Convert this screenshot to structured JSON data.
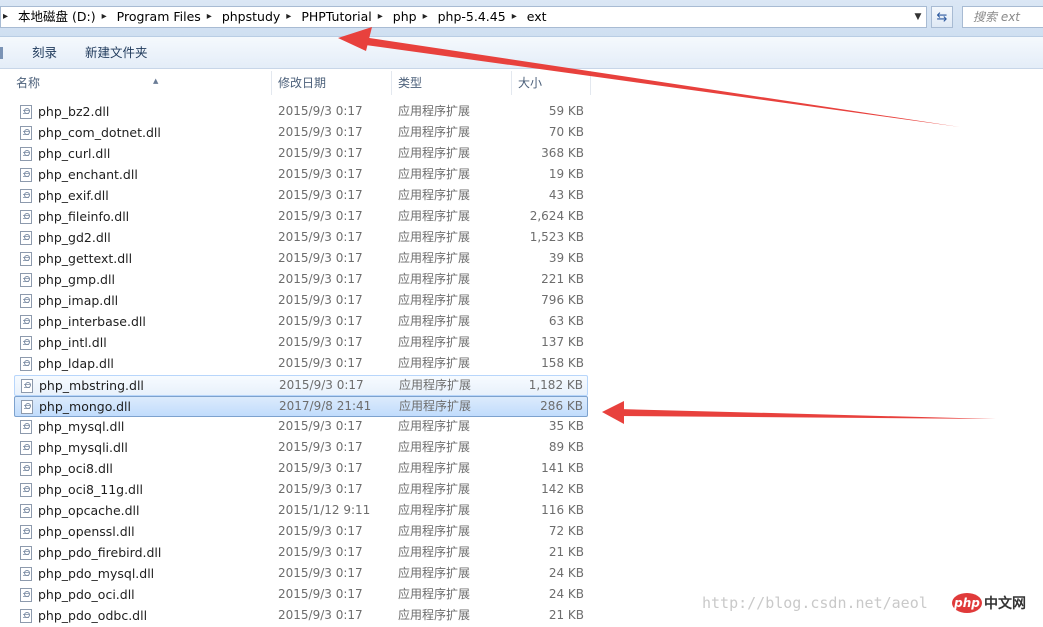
{
  "address_bar": {
    "breadcrumbs": [
      "本地磁盘 (D:)",
      "Program Files",
      "phpstudy",
      "PHPTutorial",
      "php",
      "php-5.4.45",
      "ext"
    ],
    "search_placeholder": "搜索 ext"
  },
  "toolbar": {
    "burn_label": "刻录",
    "new_folder_label": "新建文件夹"
  },
  "columns": {
    "name": "名称",
    "date": "修改日期",
    "type": "类型",
    "size": "大小"
  },
  "files": [
    {
      "name": "php_bz2.dll",
      "date": "2015/9/3 0:17",
      "type": "应用程序扩展",
      "size": "59 KB"
    },
    {
      "name": "php_com_dotnet.dll",
      "date": "2015/9/3 0:17",
      "type": "应用程序扩展",
      "size": "70 KB"
    },
    {
      "name": "php_curl.dll",
      "date": "2015/9/3 0:17",
      "type": "应用程序扩展",
      "size": "368 KB"
    },
    {
      "name": "php_enchant.dll",
      "date": "2015/9/3 0:17",
      "type": "应用程序扩展",
      "size": "19 KB"
    },
    {
      "name": "php_exif.dll",
      "date": "2015/9/3 0:17",
      "type": "应用程序扩展",
      "size": "43 KB"
    },
    {
      "name": "php_fileinfo.dll",
      "date": "2015/9/3 0:17",
      "type": "应用程序扩展",
      "size": "2,624 KB"
    },
    {
      "name": "php_gd2.dll",
      "date": "2015/9/3 0:17",
      "type": "应用程序扩展",
      "size": "1,523 KB"
    },
    {
      "name": "php_gettext.dll",
      "date": "2015/9/3 0:17",
      "type": "应用程序扩展",
      "size": "39 KB"
    },
    {
      "name": "php_gmp.dll",
      "date": "2015/9/3 0:17",
      "type": "应用程序扩展",
      "size": "221 KB"
    },
    {
      "name": "php_imap.dll",
      "date": "2015/9/3 0:17",
      "type": "应用程序扩展",
      "size": "796 KB"
    },
    {
      "name": "php_interbase.dll",
      "date": "2015/9/3 0:17",
      "type": "应用程序扩展",
      "size": "63 KB"
    },
    {
      "name": "php_intl.dll",
      "date": "2015/9/3 0:17",
      "type": "应用程序扩展",
      "size": "137 KB"
    },
    {
      "name": "php_ldap.dll",
      "date": "2015/9/3 0:17",
      "type": "应用程序扩展",
      "size": "158 KB"
    },
    {
      "name": "php_mbstring.dll",
      "date": "2015/9/3 0:17",
      "type": "应用程序扩展",
      "size": "1,182 KB"
    },
    {
      "name": "php_mongo.dll",
      "date": "2017/9/8 21:41",
      "type": "应用程序扩展",
      "size": "286 KB"
    },
    {
      "name": "php_mysql.dll",
      "date": "2015/9/3 0:17",
      "type": "应用程序扩展",
      "size": "35 KB"
    },
    {
      "name": "php_mysqli.dll",
      "date": "2015/9/3 0:17",
      "type": "应用程序扩展",
      "size": "89 KB"
    },
    {
      "name": "php_oci8.dll",
      "date": "2015/9/3 0:17",
      "type": "应用程序扩展",
      "size": "141 KB"
    },
    {
      "name": "php_oci8_11g.dll",
      "date": "2015/9/3 0:17",
      "type": "应用程序扩展",
      "size": "142 KB"
    },
    {
      "name": "php_opcache.dll",
      "date": "2015/1/12 9:11",
      "type": "应用程序扩展",
      "size": "116 KB"
    },
    {
      "name": "php_openssl.dll",
      "date": "2015/9/3 0:17",
      "type": "应用程序扩展",
      "size": "72 KB"
    },
    {
      "name": "php_pdo_firebird.dll",
      "date": "2015/9/3 0:17",
      "type": "应用程序扩展",
      "size": "21 KB"
    },
    {
      "name": "php_pdo_mysql.dll",
      "date": "2015/9/3 0:17",
      "type": "应用程序扩展",
      "size": "24 KB"
    },
    {
      "name": "php_pdo_oci.dll",
      "date": "2015/9/3 0:17",
      "type": "应用程序扩展",
      "size": "24 KB"
    },
    {
      "name": "php_pdo_odbc.dll",
      "date": "2015/9/3 0:17",
      "type": "应用程序扩展",
      "size": "21 KB"
    }
  ],
  "hover_row": 13,
  "selected_row": 14,
  "watermark": {
    "url_text": "http://blog.csdn.net/aeol",
    "logo_mark": "php",
    "logo_text": "中文网"
  },
  "colors": {
    "arrow": "#e8413d",
    "selection": "#c1dcfc",
    "header_text": "#4c607a"
  }
}
